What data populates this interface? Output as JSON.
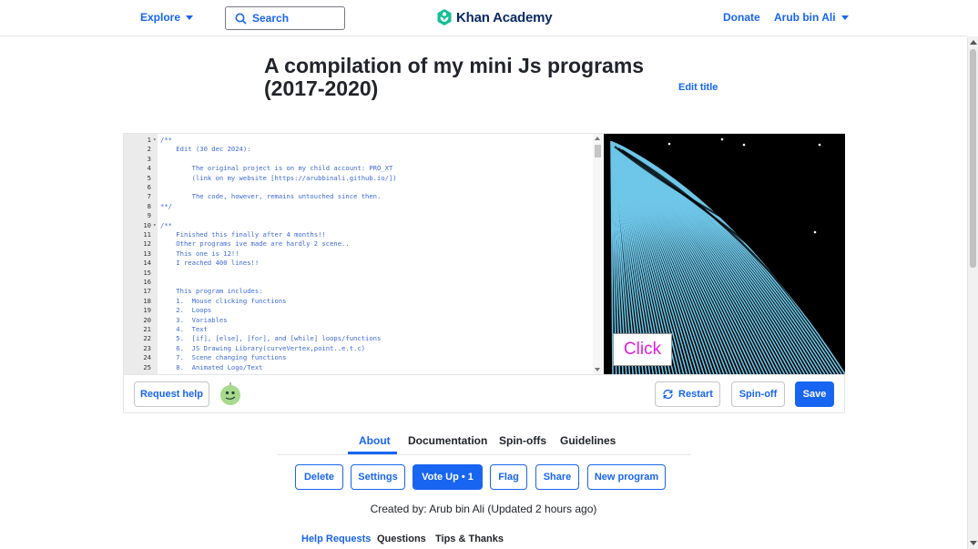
{
  "nav": {
    "explore": "Explore",
    "search_placeholder": "Search",
    "logo_text": "Khan Academy",
    "donate": "Donate",
    "user": "Arub bin Ali"
  },
  "program": {
    "title": "A compilation of my mini Js programs (2017-2020)",
    "edit_title": "Edit title"
  },
  "code_lines": [
    {
      "n": "1",
      "fold": true,
      "text": "/**"
    },
    {
      "n": "2",
      "fold": false,
      "text": "    Edit (30 dec 2024):"
    },
    {
      "n": "3",
      "fold": false,
      "text": ""
    },
    {
      "n": "4",
      "fold": false,
      "text": "        The original project is on my child account: PRO_XT"
    },
    {
      "n": "5",
      "fold": false,
      "text": "        (link on my website [https://arubbinali.github.io/])"
    },
    {
      "n": "6",
      "fold": false,
      "text": ""
    },
    {
      "n": "7",
      "fold": false,
      "text": "        The code, however, remains untouched since then."
    },
    {
      "n": "8",
      "fold": false,
      "text": "**/"
    },
    {
      "n": "9",
      "fold": false,
      "text": ""
    },
    {
      "n": "10",
      "fold": true,
      "text": "/**"
    },
    {
      "n": "11",
      "fold": false,
      "text": "    Finished this finally after 4 months!!"
    },
    {
      "n": "12",
      "fold": false,
      "text": "    Other programs ive made are hardly 2 scene.."
    },
    {
      "n": "13",
      "fold": false,
      "text": "    This one is 12!!"
    },
    {
      "n": "14",
      "fold": false,
      "text": "    I reached 400 lines!!"
    },
    {
      "n": "15",
      "fold": false,
      "text": ""
    },
    {
      "n": "16",
      "fold": false,
      "text": ""
    },
    {
      "n": "17",
      "fold": false,
      "text": "    This program includes:"
    },
    {
      "n": "18",
      "fold": false,
      "text": "    1.  Mouse clicking functions"
    },
    {
      "n": "19",
      "fold": false,
      "text": "    2.  Loops"
    },
    {
      "n": "20",
      "fold": false,
      "text": "    3.  Variables"
    },
    {
      "n": "21",
      "fold": false,
      "text": "    4.  Text"
    },
    {
      "n": "22",
      "fold": false,
      "text": "    5.  [if], [else], [for], and [while] loops/functions"
    },
    {
      "n": "23",
      "fold": false,
      "text": "    6.  JS Drawing Library(curveVertex,point..e.t.c)"
    },
    {
      "n": "24",
      "fold": false,
      "text": "    7.  Scene changing functions"
    },
    {
      "n": "25",
      "fold": false,
      "text": "    8.  Animated Logo/Text"
    }
  ],
  "canvas": {
    "click_label": "Click"
  },
  "editor_toolbar": {
    "request_help": "Request help",
    "restart": "Restart",
    "spin_off": "Spin-off",
    "save": "Save"
  },
  "tabs": {
    "about": "About",
    "documentation": "Documentation",
    "spin_offs": "Spin-offs",
    "guidelines": "Guidelines"
  },
  "actions": {
    "delete": "Delete",
    "settings": "Settings",
    "vote_up": "Vote Up • 1",
    "flag": "Flag",
    "share": "Share",
    "new_program": "New program"
  },
  "created_by": "Created by: Arub bin Ali (Updated 2 hours ago)",
  "help_tabs": {
    "help_requests": "Help Requests",
    "questions": "Questions",
    "tips_thanks": "Tips & Thanks"
  },
  "colors": {
    "brand_blue": "#1865f2",
    "logo_green": "#14bf96",
    "canvas_bg": "#000000",
    "stripe_color": "#6ec6e8",
    "click_text": "#e020e0"
  }
}
